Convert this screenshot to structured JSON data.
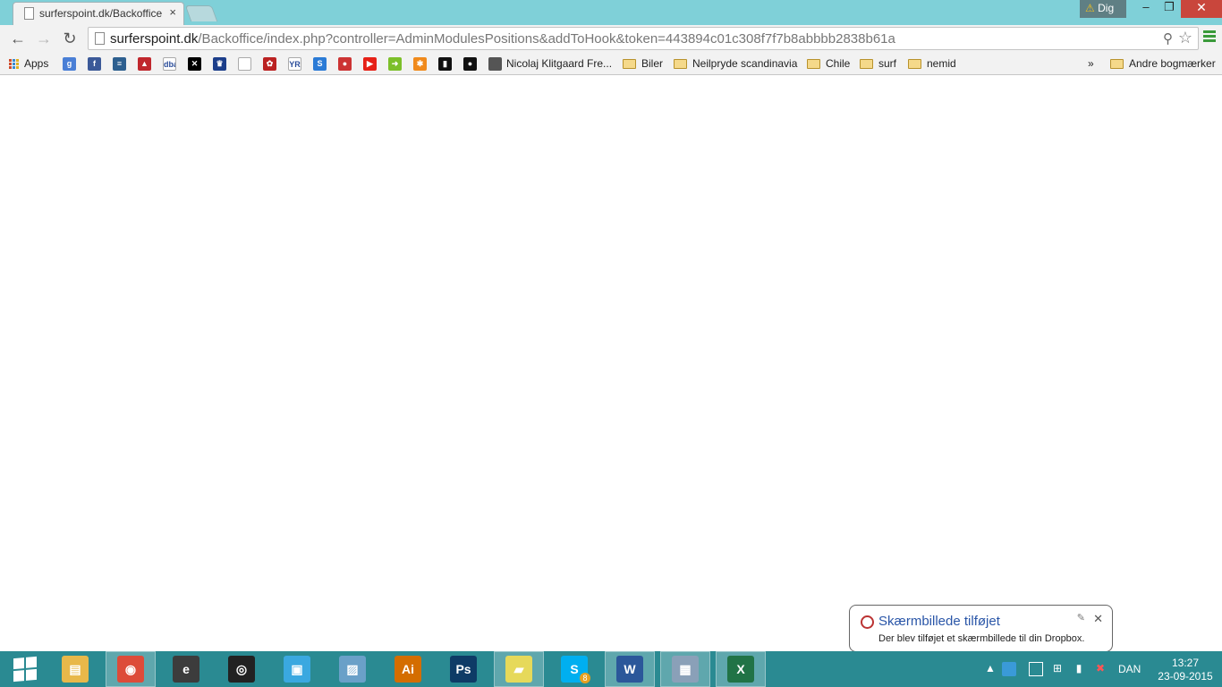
{
  "browser": {
    "tabs": [
      {
        "title": "surferspoint.dk/Backoffice",
        "close": "×"
      }
    ],
    "warning_label": "Dig",
    "window_controls": {
      "minimize": "–",
      "maximize": "❐",
      "close": "✕"
    },
    "url_host": "surferspoint.dk",
    "url_rest": "/Backoffice/index.php?controller=AdminModulesPositions&addToHook&token=443894c01c308f7f7b8abbbb2838b61a"
  },
  "bookmarks": {
    "apps": "Apps",
    "items": [
      {
        "icon": "google-icon",
        "color": "#4a7fd6",
        "glyph": "g"
      },
      {
        "icon": "facebook-icon",
        "color": "#3b5998",
        "glyph": "f"
      },
      {
        "icon": "news-icon",
        "color": "#2d5f8f",
        "glyph": "≡"
      },
      {
        "icon": "red-triangle-icon",
        "color": "#c0272d",
        "glyph": "▲"
      },
      {
        "icon": "dba-icon",
        "color": "#ffffff",
        "glyph": "dba"
      },
      {
        "icon": "x-icon",
        "color": "#000000",
        "glyph": "✕"
      },
      {
        "icon": "crown-icon",
        "color": "#1c3e8a",
        "glyph": "♛"
      },
      {
        "icon": "blank-page-icon",
        "color": "#ffffff",
        "glyph": ""
      },
      {
        "icon": "emblem-icon",
        "color": "#b22",
        "glyph": "✿"
      },
      {
        "icon": "yr-icon",
        "color": "#ffffff",
        "glyph": "YR"
      },
      {
        "icon": "s-icon",
        "color": "#2b7bd6",
        "glyph": "S"
      },
      {
        "icon": "car-icon",
        "color": "#c33",
        "glyph": "●"
      },
      {
        "icon": "youtube-icon",
        "color": "#e62117",
        "glyph": "▶"
      },
      {
        "icon": "green-arrow-icon",
        "color": "#7cbf2a",
        "glyph": "➜"
      },
      {
        "icon": "orange-grid-icon",
        "color": "#f08a1c",
        "glyph": "✱"
      },
      {
        "icon": "black-box-icon",
        "color": "#111111",
        "glyph": "▮"
      },
      {
        "icon": "black-circle-icon",
        "color": "#111111",
        "glyph": "●"
      }
    ],
    "named": [
      {
        "label": "Nicolaj Klitgaard Fre...",
        "kind": "photo"
      },
      {
        "label": "Biler",
        "kind": "folder"
      },
      {
        "label": "Neilpryde scandinavia",
        "kind": "folder"
      },
      {
        "label": "Chile",
        "kind": "folder"
      },
      {
        "label": "surf",
        "kind": "folder"
      },
      {
        "label": "nemid",
        "kind": "folder"
      }
    ],
    "overflow": "»",
    "other": "Andre bogmærker"
  },
  "notification": {
    "title": "Skærmbillede tilføjet",
    "message": "Der blev tilføjet et skærmbillede til din Dropbox.",
    "close": "✕",
    "pin": "✎"
  },
  "taskbar": {
    "apps": [
      {
        "name": "file-explorer",
        "glyph": "▤",
        "color": "#e8b84a"
      },
      {
        "name": "chrome",
        "glyph": "◉",
        "color": "#dd4b39",
        "active": true
      },
      {
        "name": "app-e",
        "glyph": "e",
        "color": "#3c3c3c"
      },
      {
        "name": "camera",
        "glyph": "◎",
        "color": "#222222"
      },
      {
        "name": "store",
        "glyph": "▣",
        "color": "#3aa8e0"
      },
      {
        "name": "photos",
        "glyph": "▨",
        "color": "#6aa0c8"
      },
      {
        "name": "illustrator",
        "glyph": "Ai",
        "color": "#d46d00"
      },
      {
        "name": "photoshop",
        "glyph": "Ps",
        "color": "#0e3b66"
      },
      {
        "name": "sticky-notes",
        "glyph": "▰",
        "color": "#e6d95a",
        "active": true
      },
      {
        "name": "skype",
        "glyph": "S",
        "color": "#00aff0",
        "badge": "8"
      },
      {
        "name": "word",
        "glyph": "W",
        "color": "#2b579a",
        "active": true
      },
      {
        "name": "calculator",
        "glyph": "▦",
        "color": "#8aa0b8",
        "active": true
      },
      {
        "name": "excel",
        "glyph": "X",
        "color": "#217346",
        "active": true
      }
    ],
    "tray_arrow": "▲",
    "language": "DAN",
    "time": "13:27",
    "date": "23-09-2015"
  }
}
